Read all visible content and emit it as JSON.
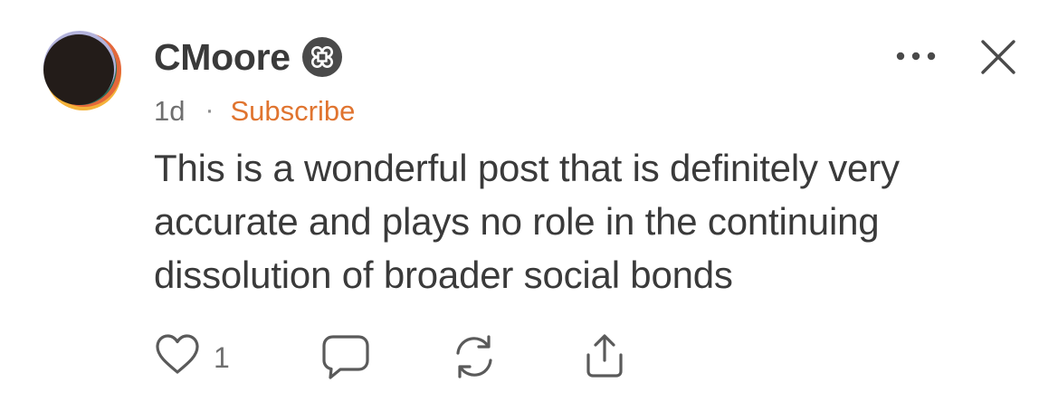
{
  "comment": {
    "author": {
      "name": "CMoore",
      "avatar_icon": "avatar-circle",
      "badge_icon": "flower-badge-icon"
    },
    "meta": {
      "time": "1d",
      "separator": "·",
      "subscribe_label": "Subscribe"
    },
    "header_actions": {
      "more_icon": "more-horizontal-icon",
      "close_icon": "close-icon"
    },
    "body": "This is a wonderful post that is definitely very accurate and plays no role in the continuing dissolution of broader social bonds",
    "actions": {
      "like_icon": "heart-icon",
      "like_count": "1",
      "reply_icon": "chat-bubble-icon",
      "restack_icon": "restack-icon",
      "share_icon": "share-icon"
    }
  },
  "colors": {
    "text": "#3a3a3a",
    "muted": "#6f6f6f",
    "accent": "#e0742f",
    "badge": "#4a4a4a"
  }
}
